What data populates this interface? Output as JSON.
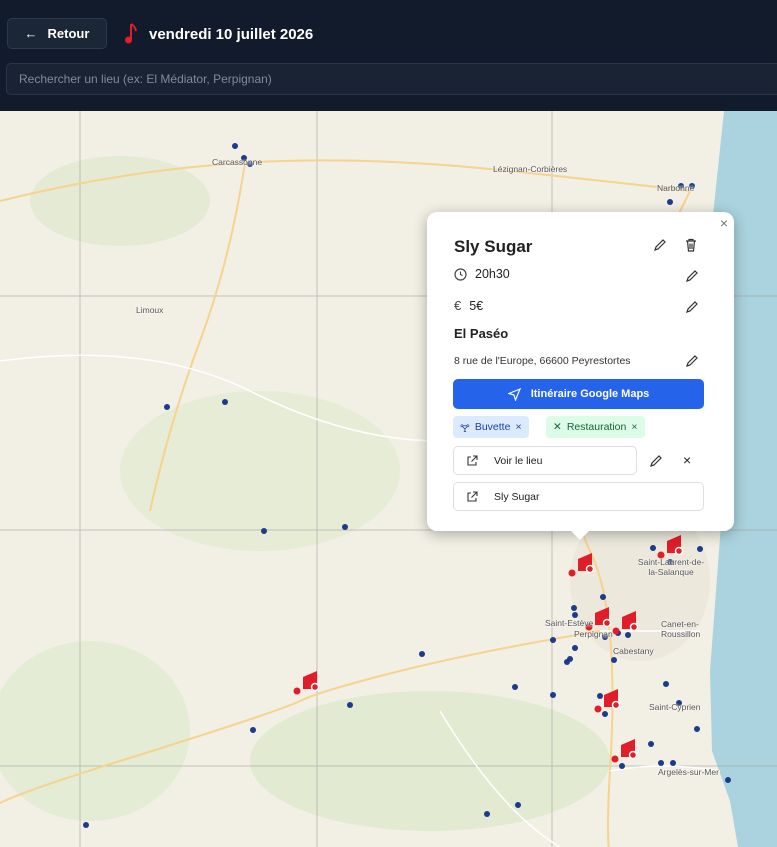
{
  "header": {
    "back_label": "Retour",
    "date_title": "vendredi 10 juillet 2026"
  },
  "search": {
    "placeholder": "Rechercher un lieu (ex: El Médiator, Perpignan)"
  },
  "map": {
    "cities": [
      "Carcassonne",
      "Lézignan-Corbières",
      "Narbonne",
      "Limoux",
      "Saint-Laurent-de-la-Salanque",
      "Saint-Estève",
      "Perpignan",
      "Canet-en-Roussillon",
      "Cabestany",
      "Saint-Cyprien",
      "Argelès-sur-Mer"
    ],
    "marker_color": "#e11d2a",
    "venue_dot_color": "#1e3a8a"
  },
  "popup": {
    "close": "×",
    "artist": "Sly Sugar",
    "time": "20h30",
    "price": "5€",
    "venue": "El Paséo",
    "address": "8 rue de l'Europe, 66600 Peyrestortes",
    "route_label": "Itinéraire Google Maps",
    "tags": [
      {
        "label": "Buvette",
        "color": "#dbeafe",
        "text_color": "#1e40af"
      },
      {
        "label": "Restauration",
        "color": "#dcfce7",
        "text_color": "#166534"
      }
    ],
    "tag_remove": "×",
    "venue_link_label": "Voir le lieu",
    "artist_link_label": "Sly Sugar",
    "remove_link": "×"
  }
}
